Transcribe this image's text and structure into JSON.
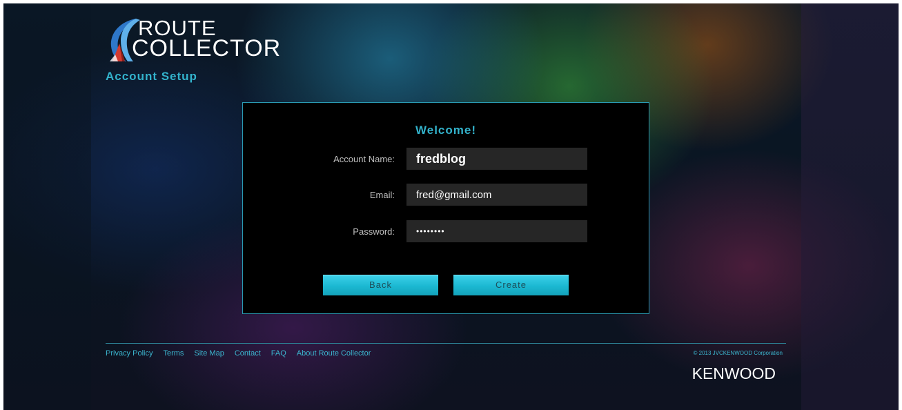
{
  "header": {
    "logo_line1": "ROUTE",
    "logo_line2": "COLLECTOR",
    "page_title": "Account Setup"
  },
  "form": {
    "heading": "Welcome!",
    "fields": [
      {
        "label": "Account Name:",
        "value": "fredblog"
      },
      {
        "label": "Email:",
        "value": "fred@gmail.com"
      },
      {
        "label": "Password:",
        "value": "••••••••"
      }
    ],
    "back_label": "Back",
    "create_label": "Create"
  },
  "footer": {
    "links": [
      "Privacy Policy",
      "Terms",
      "Site Map",
      "Contact",
      "FAQ",
      "About Route Collector"
    ],
    "copyright": "© 2013 JVCKENWOOD Corporation",
    "brand": "KENWOOD"
  },
  "colors": {
    "accent": "#33b3cc",
    "button": "#1bb8d2",
    "panel_bg": "#000000",
    "field_bg": "#262626"
  },
  "icons": {
    "logo": "route-collector-road-logo-icon"
  }
}
